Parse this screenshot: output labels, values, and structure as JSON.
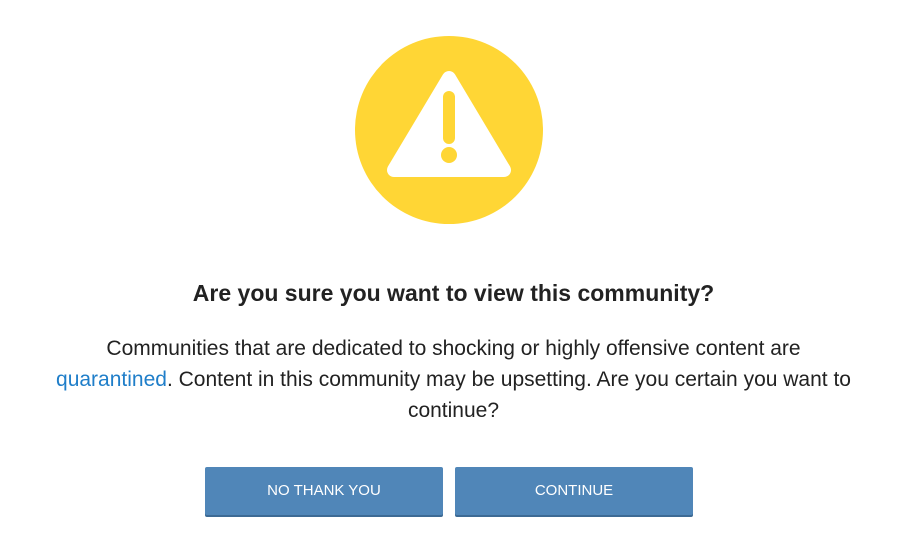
{
  "colors": {
    "warning_circle": "#ffd635",
    "warning_symbol": "#ffffff",
    "link": "#1f7ec9",
    "button_bg": "#5086b8",
    "button_text": "#ffffff",
    "text": "#222222"
  },
  "icon": "warning-icon",
  "dialog": {
    "title": "Are you sure you want to view this community?",
    "message_before_link": "Communities that are dedicated to shocking or highly offensive content are ",
    "link_text": "quarantined",
    "message_after_link": ". Content in this community may be upsetting. Are you certain you want to continue?"
  },
  "buttons": {
    "no_thank_you": "NO THANK YOU",
    "continue": "CONTINUE"
  }
}
